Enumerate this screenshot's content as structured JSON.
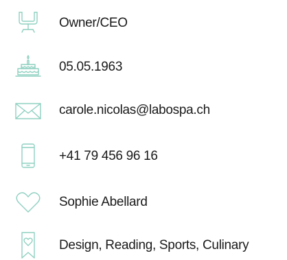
{
  "accent_color": "#8fd0c0",
  "profile": {
    "items": [
      {
        "icon": "chair-icon",
        "label": "Owner/CEO"
      },
      {
        "icon": "birthday-cake-icon",
        "label": "05.05.1963"
      },
      {
        "icon": "envelope-icon",
        "label": "carole.nicolas@labospa.ch"
      },
      {
        "icon": "mobile-phone-icon",
        "label": "+41 79 456 96 16"
      },
      {
        "icon": "heart-icon",
        "label": "Sophie Abellard"
      },
      {
        "icon": "bookmark-heart-icon",
        "label": "Design, Reading, Sports, Culinary"
      }
    ]
  }
}
